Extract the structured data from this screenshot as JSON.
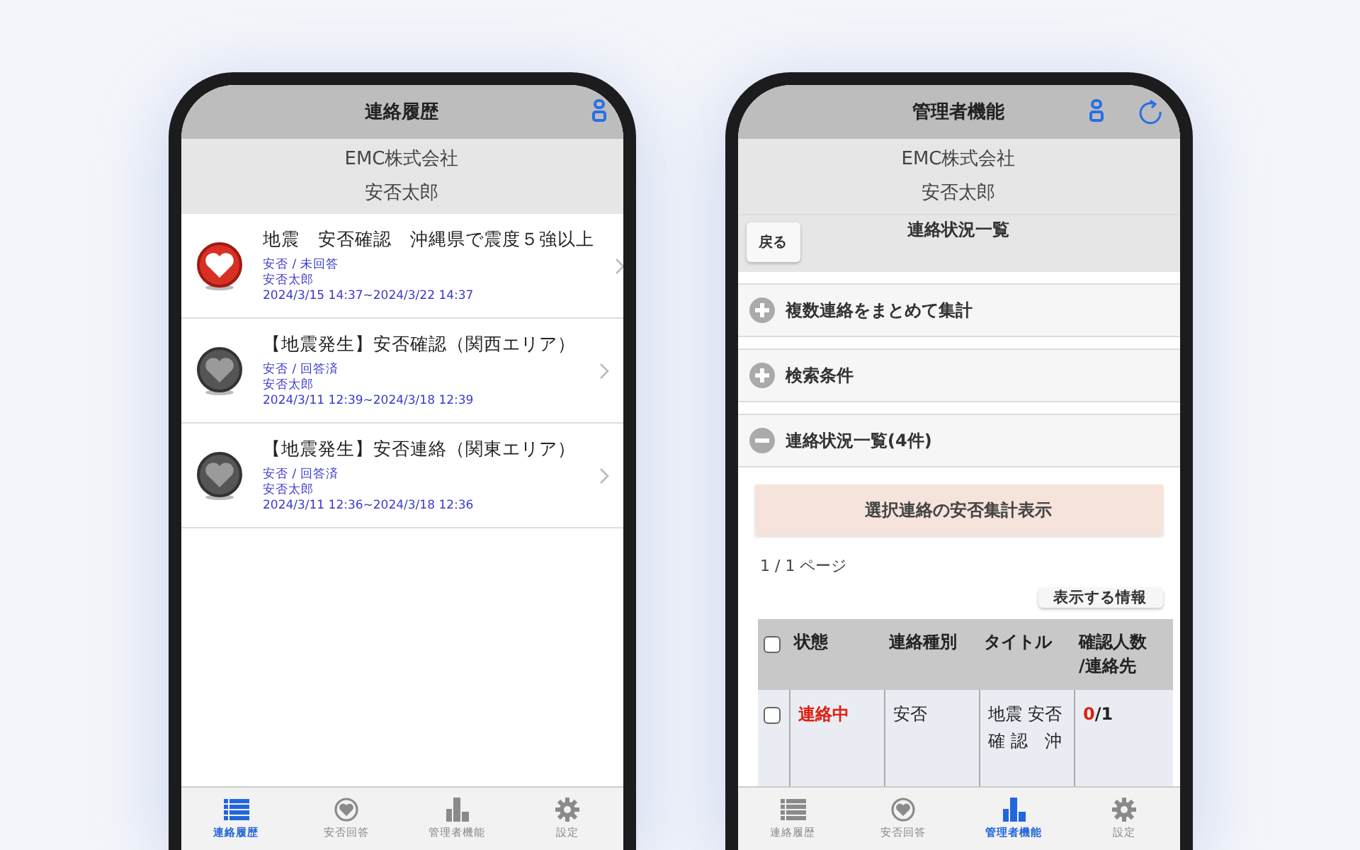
{
  "phones": [
    {
      "kind": "history",
      "title": "連絡履歴",
      "company": "EMC株式会社",
      "user": "安否太郎",
      "items": [
        {
          "title": "地震　安否確認　沖縄県で震度５強以上",
          "status": "安否 / 未回答",
          "name": "安否太郎",
          "period": "2024/3/15 14:37~2024/3/22 14:37",
          "answered": false
        },
        {
          "title": "【地震発生】安否確認（関西エリア）",
          "status": "安否 / 回答済",
          "name": "安否太郎",
          "period": "2024/3/11 12:39~2024/3/18 12:39",
          "answered": true
        },
        {
          "title": "【地震発生】安否連絡（関東エリア）",
          "status": "安否 / 回答済",
          "name": "安否太郎",
          "period": "2024/3/11 12:36~2024/3/18 12:36",
          "answered": true
        }
      ],
      "tabs": [
        {
          "label": "連絡履歴",
          "selected": true
        },
        {
          "label": "安否回答",
          "selected": false
        },
        {
          "label": "管理者機能",
          "selected": false
        },
        {
          "label": "設定",
          "selected": false
        }
      ]
    },
    {
      "kind": "admin",
      "title": "管理者機能",
      "company": "EMC株式会社",
      "user": "安否太郎",
      "page_title": "連絡状況一覧",
      "back": "戻る",
      "sections": [
        {
          "label": "複数連絡をまとめて集計",
          "expanded": false
        },
        {
          "label": "検索条件",
          "expanded": false
        },
        {
          "label": "連絡状況一覧(4件)",
          "expanded": true
        }
      ],
      "action": "選択連絡の安否集計表示",
      "pager": "1 / 1 ページ",
      "display_button": "表示する情報",
      "columns": [
        "状態",
        "連絡種別",
        "タイトル",
        "確認人数\n/連絡先"
      ],
      "rows": [
        {
          "checked": false,
          "status": "連絡中",
          "type": "安否",
          "title": "地震 安否確 認　沖",
          "confirmed": "0",
          "total": "/1"
        }
      ],
      "tabs": [
        {
          "label": "連絡履歴",
          "selected": false
        },
        {
          "label": "安否回答",
          "selected": false
        },
        {
          "label": "管理者機能",
          "selected": true
        },
        {
          "label": "設定",
          "selected": false
        }
      ]
    }
  ]
}
